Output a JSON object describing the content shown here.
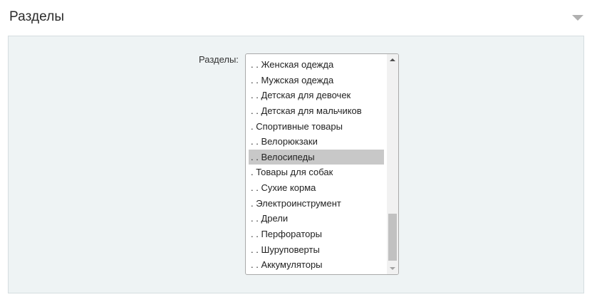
{
  "section": {
    "title": "Разделы",
    "toggle_icon": "triangle-down"
  },
  "form": {
    "sections_label": "Разделы:",
    "options": [
      ". . Женская одежда",
      ". . Мужская одежда",
      ". . Детская для девочек",
      ". . Детская для мальчиков",
      ". Спортивные товары",
      ". . Велорюкзаки",
      ". . Велосипеды",
      ". Товары для собак",
      ". . Сухие корма",
      ". Электроинструмент",
      ". . Дрели",
      ". . Перфораторы",
      ". . Шуруповерты",
      ". . Аккумуляторы"
    ],
    "selected_option": ". . Велосипеды"
  },
  "colors": {
    "panel_background": "#eef3f4",
    "selected_background": "#c8c8c8",
    "toggle_icon": "#b0b0b0"
  }
}
